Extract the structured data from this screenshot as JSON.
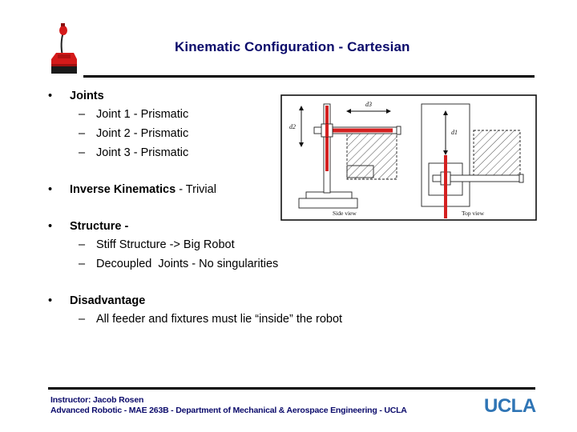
{
  "header": {
    "title": "Kinematic Configuration - Cartesian",
    "logo_icon": "red-robot-logo"
  },
  "bullets": [
    {
      "marker": "•",
      "label": "Joints",
      "suffix": "",
      "subitems": [
        {
          "marker": "–",
          "text": "Joint 1 - Prismatic"
        },
        {
          "marker": "–",
          "text": "Joint 2 - Prismatic"
        },
        {
          "marker": "–",
          "text": "Joint 3 - Prismatic"
        }
      ]
    },
    {
      "marker": "•",
      "label": "Inverse Kinematics",
      "suffix": " - Trivial",
      "subitems": []
    },
    {
      "marker": "•",
      "label": "Structure -",
      "suffix": "",
      "subitems": [
        {
          "marker": "–",
          "text": "Stiff Structure -> Big Robot"
        },
        {
          "marker": "–",
          "text": "Decoupled  Joints - No singularities"
        }
      ]
    },
    {
      "marker": "•",
      "label": "Disadvantage",
      "suffix": "",
      "subitems": [
        {
          "marker": "–",
          "text": "All feeder and fixtures must lie “inside” the robot"
        }
      ]
    }
  ],
  "figure": {
    "side_view_caption": "Side view",
    "top_view_caption": "Top view",
    "label_d1": "d1",
    "label_d2": "d2",
    "label_d3": "d3",
    "highlight_color": "#d42020"
  },
  "footer": {
    "line1": "Instructor: Jacob Rosen",
    "line2": "Advanced Robotic - MAE 263B - Department of Mechanical & Aerospace Engineering - UCLA",
    "brand": "UCLA",
    "brand_color": "#2f75b5",
    "text_color": "#0b0b6b"
  }
}
